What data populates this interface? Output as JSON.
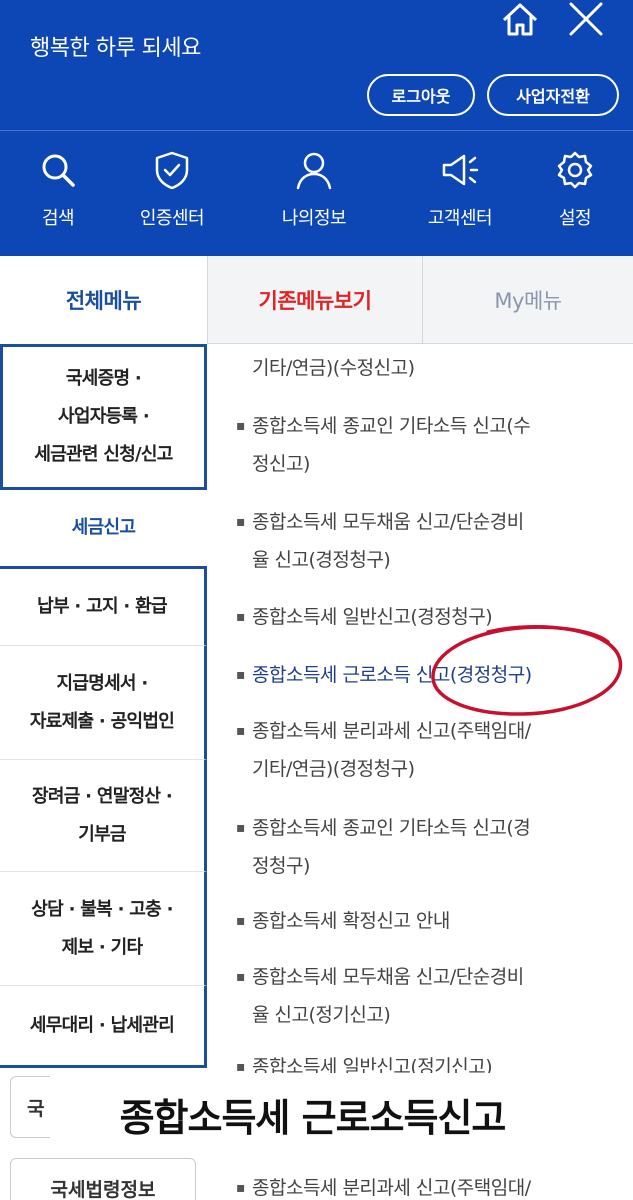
{
  "header": {
    "greeting": "행복한 하루 되세요",
    "logout_label": "로그아웃",
    "switch_label": "사업자전환",
    "quick_menu": [
      {
        "label": "검색",
        "icon": "search-icon"
      },
      {
        "label": "인증센터",
        "icon": "shield-check-icon"
      },
      {
        "label": "나의정보",
        "icon": "user-icon"
      },
      {
        "label": "고객센터",
        "icon": "megaphone-icon"
      },
      {
        "label": "설정",
        "icon": "gear-icon"
      }
    ]
  },
  "tabs": {
    "all": "전체메뉴",
    "old": "기존메뉴보기",
    "my": "My메뉴"
  },
  "left_menu": [
    {
      "lines": [
        "국세증명 ·",
        "사업자등록 ·",
        "세금관련 신청/신고"
      ]
    },
    {
      "lines": [
        "세금신고"
      ],
      "active": true
    },
    {
      "lines": [
        "납부 · 고지 · 환급"
      ]
    },
    {
      "lines": [
        "지급명세서 ·",
        "자료제출 · 공익법인"
      ]
    },
    {
      "lines": [
        "장려금 · 연말정산 ·",
        "기부금"
      ]
    },
    {
      "lines": [
        "상담 · 불복 · 고충 ·",
        "제보 · 기타"
      ]
    },
    {
      "lines": [
        "세무대리 · 납세관리"
      ]
    }
  ],
  "bottom_boxes": [
    {
      "label": "국"
    },
    {
      "label": "국세법령정보"
    }
  ],
  "right_list": [
    {
      "lines": [
        "기타/연금)(수정신고)"
      ],
      "bullet": false
    },
    {
      "lines": [
        "종합소득세 종교인 기타소득 신고(수",
        "정신고)"
      ]
    },
    {
      "lines": [
        "종합소득세 모두채움 신고/단순경비",
        "율 신고(경정청구)"
      ]
    },
    {
      "lines": [
        "종합소득세 일반신고(경정청구)"
      ]
    },
    {
      "lines": [
        "종합소득세 근로소득 신고(경정청구)"
      ],
      "highlight": true
    },
    {
      "lines": [
        "종합소득세 분리과세 신고(주택임대/",
        "기타/연금)(경정청구)"
      ]
    },
    {
      "lines": [
        "종합소득세 종교인 기타소득 신고(경",
        "정청구)"
      ]
    },
    {
      "lines": [
        "종합소득세 확정신고 안내"
      ]
    },
    {
      "lines": [
        "종합소득세 모두채움 신고/단순경비",
        "율 신고(정기신고)"
      ]
    },
    {
      "lines": [
        "종합소득세 일반신고(정기신고)"
      ]
    },
    {
      "lines": [
        "종합소득세 분리과세 신고(주택임대/"
      ]
    }
  ],
  "caption": "종합소득세 근로소득신고",
  "colors": {
    "header_bg": "#0d47b5",
    "accent_blue": "#1a4fa0",
    "tab_red": "#e02424",
    "annotation_red": "#c8102e"
  }
}
